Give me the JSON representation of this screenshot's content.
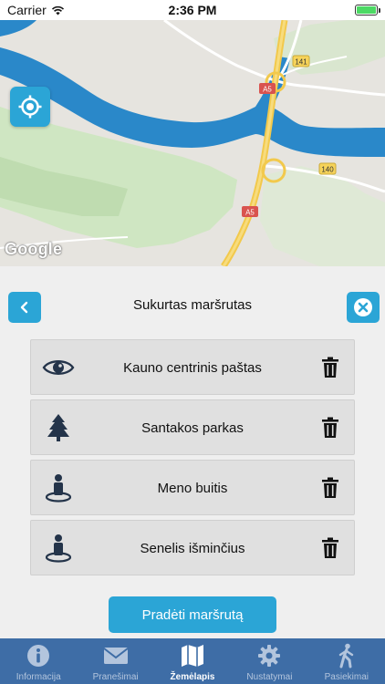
{
  "status_bar": {
    "carrier": "Carrier",
    "time": "2:36 PM",
    "battery_level": 1.0
  },
  "map": {
    "attribution": "Google",
    "road_labels": [
      "141",
      "A5",
      "140",
      "A5"
    ],
    "locate_icon": "crosshair-icon"
  },
  "route": {
    "title": "Sukurtas maršrutas",
    "back_icon": "chevron-left-icon",
    "close_icon": "close-icon",
    "items": [
      {
        "label": "Kauno centrinis paštas",
        "icon": "eye-icon"
      },
      {
        "label": "Santakos parkas",
        "icon": "tree-icon"
      },
      {
        "label": "Meno buitis",
        "icon": "person-pin-icon"
      },
      {
        "label": "Senelis išminčius",
        "icon": "person-pin-icon"
      }
    ],
    "delete_icon": "trash-icon",
    "start_label": "Pradėti maršrutą"
  },
  "tabs": [
    {
      "label": "Informacija",
      "icon": "info-icon",
      "active": false
    },
    {
      "label": "Pranešimai",
      "icon": "mail-icon",
      "active": false
    },
    {
      "label": "Žemėlapis",
      "icon": "map-icon",
      "active": true
    },
    {
      "label": "Nustatymai",
      "icon": "gear-icon",
      "active": false
    },
    {
      "label": "Pasiekimai",
      "icon": "walking-icon",
      "active": false
    }
  ],
  "colors": {
    "accent": "#2ba5d6",
    "tab_bar": "#3e6da6",
    "river": "#2a88c9",
    "highway": "#f2c94c",
    "park": "#cfe6c2"
  }
}
